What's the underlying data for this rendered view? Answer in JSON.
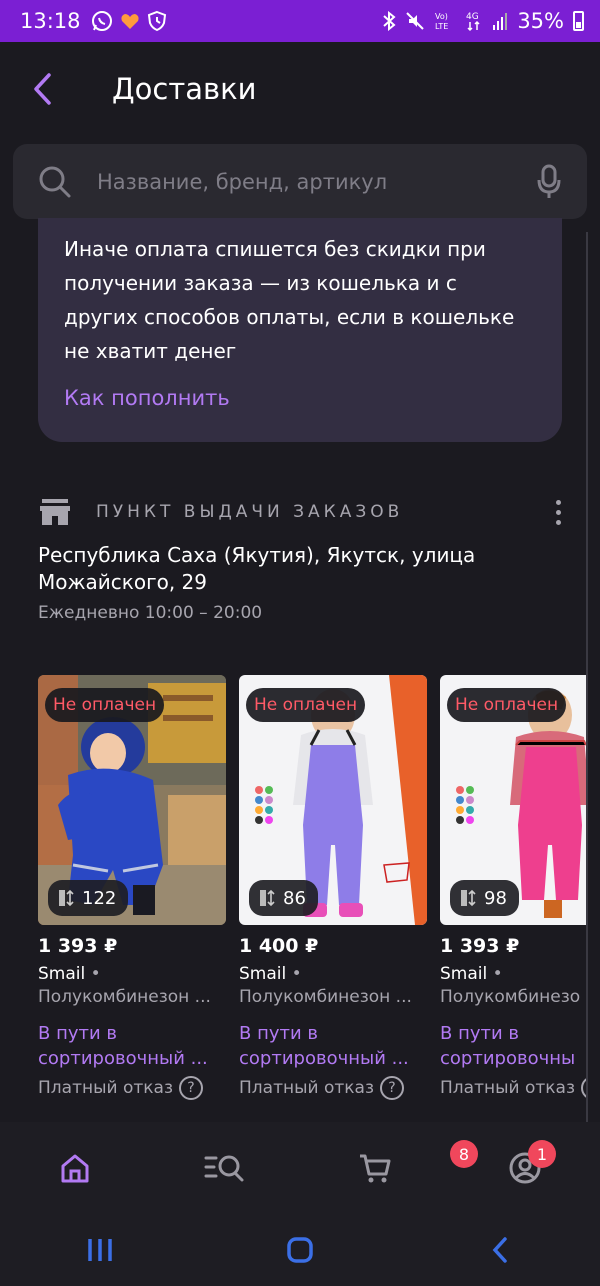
{
  "status_bar": {
    "time": "13:18",
    "battery": "35%",
    "network": "4G"
  },
  "header": {
    "title": "Доставки"
  },
  "search": {
    "placeholder": "Название, бренд, артикул"
  },
  "info_card": {
    "text": "Иначе оплата спишется без скидки при получении заказа — из кошелька и с других способов оплаты, если в кошельке не хватит денег",
    "link": "Как пополнить"
  },
  "pickup": {
    "label": "ПУНКТ ВЫДАЧИ ЗАКАЗОВ",
    "address": "Республика Саха (Якутия), Якутск, улица Можайского, 29",
    "hours": "Ежедневно 10:00 – 20:00"
  },
  "products": [
    {
      "badge": "Не оплачен",
      "count": "122",
      "price": "1 393 ₽",
      "brand": "Smail",
      "name": "Полукомбинезон ...",
      "status_line1": "В пути в",
      "status_line2": "сортировочный ...",
      "refund": "Платный отказ"
    },
    {
      "badge": "Не оплачен",
      "count": "86",
      "price": "1 400 ₽",
      "brand": "Smail",
      "name": "Полукомбинезон ...",
      "status_line1": "В пути в",
      "status_line2": "сортировочный ...",
      "refund": "Платный отказ"
    },
    {
      "badge": "Не оплачен",
      "count": "98",
      "price": "1 393 ₽",
      "brand": "Smail",
      "name": "Полукомбинезо",
      "status_line1": "В пути в",
      "status_line2": "сортировочны",
      "refund": "Платный отказ"
    }
  ],
  "bottom_nav": {
    "cart_count": "8",
    "profile_count": "1"
  },
  "colors": {
    "accent": "#b27af3",
    "status_bar": "#7b1fd3",
    "badge_red": "#ff5a67",
    "background": "#1b1a20"
  }
}
